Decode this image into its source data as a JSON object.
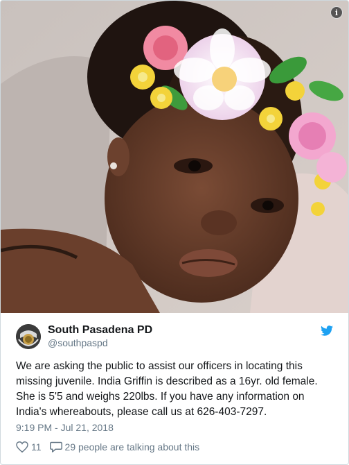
{
  "tweet": {
    "display_name": "South Pasadena PD",
    "handle": "@southpaspd",
    "text": "We are asking the public to assist our officers in locating this\nmissing juvenile.  India Griffin is described as a 16yr. old female.\nShe is 5'5 and weighs 220lbs. If you have any information on\nIndia's whereabouts, please call us at 626-403-7297.",
    "timestamp": "9:19 PM - Jul 21, 2018",
    "likes": "11",
    "talking": "29 people are talking about this"
  },
  "icons": {
    "info": "info-icon",
    "twitter": "twitter-bird-icon",
    "like": "heart-icon",
    "reply": "speech-bubble-icon"
  },
  "colors": {
    "twitter_blue": "#1da1f2",
    "secondary_text": "#657786",
    "primary_text": "#14171a",
    "border": "#cfd9de"
  }
}
